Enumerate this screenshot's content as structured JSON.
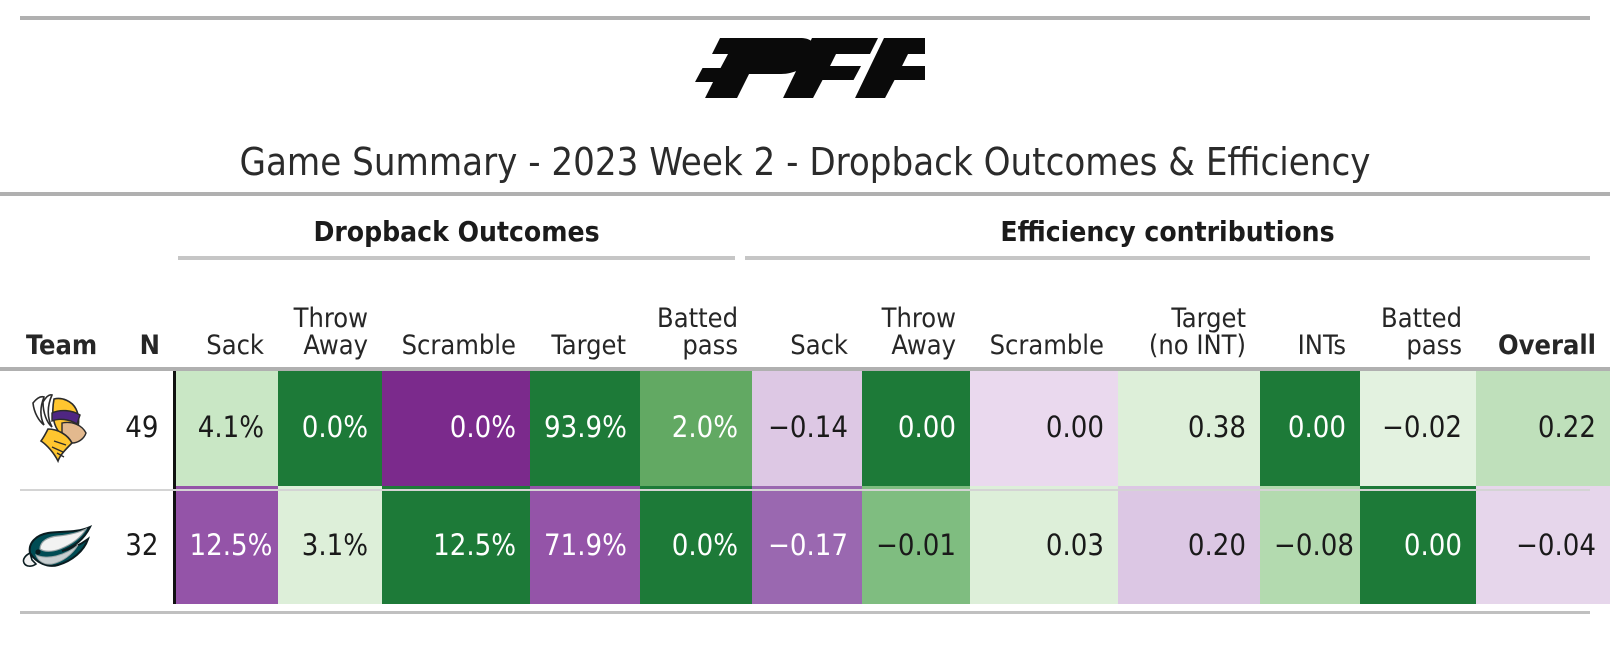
{
  "brand": {
    "logo_text": "PFF",
    "logo_name": "pff-logo"
  },
  "title": "Game Summary - 2023 Week 2 - Dropback Outcomes & Efficiency",
  "groups": {
    "left": "Dropback Outcomes",
    "right": "Efficiency contributions"
  },
  "columns": [
    {
      "key": "team",
      "label": "Team",
      "bold": true
    },
    {
      "key": "n",
      "label": "N",
      "bold": true
    },
    {
      "key": "o_sack",
      "label": "Sack",
      "bold": false
    },
    {
      "key": "o_throw",
      "label": "Throw\nAway",
      "bold": false
    },
    {
      "key": "o_scr",
      "label": "Scramble",
      "bold": false
    },
    {
      "key": "o_tgt",
      "label": "Target",
      "bold": false
    },
    {
      "key": "o_batted",
      "label": "Batted\npass",
      "bold": false
    },
    {
      "key": "e_sack",
      "label": "Sack",
      "bold": false
    },
    {
      "key": "e_throw",
      "label": "Throw\nAway",
      "bold": false
    },
    {
      "key": "e_scr",
      "label": "Scramble",
      "bold": false
    },
    {
      "key": "e_tgt",
      "label": "Target\n(no INT)",
      "bold": false
    },
    {
      "key": "e_int",
      "label": "INTs",
      "bold": false
    },
    {
      "key": "e_batted",
      "label": "Batted\npass",
      "bold": false
    },
    {
      "key": "e_overall",
      "label": "Overall",
      "bold": true
    }
  ],
  "rows": [
    {
      "team": "Minnesota Vikings",
      "team_logo": "vikings-logo",
      "n": "49",
      "cells": [
        {
          "value": "4.1%",
          "bg": "#c9e7c5",
          "fg": "#1a1a1a"
        },
        {
          "value": "0.0%",
          "bg": "#1d7a38",
          "fg": "#ffffff"
        },
        {
          "value": "0.0%",
          "bg": "#7b2a8c",
          "fg": "#ffffff"
        },
        {
          "value": "93.9%",
          "bg": "#1d7a38",
          "fg": "#ffffff"
        },
        {
          "value": "2.0%",
          "bg": "#62a963",
          "fg": "#ffffff"
        },
        {
          "value": "−0.14",
          "bg": "#ddc8e4",
          "fg": "#1a1a1a"
        },
        {
          "value": "0.00",
          "bg": "#1d7a38",
          "fg": "#ffffff"
        },
        {
          "value": "0.00",
          "bg": "#ead9ee",
          "fg": "#1a1a1a"
        },
        {
          "value": "0.38",
          "bg": "#ddefd9",
          "fg": "#1a1a1a"
        },
        {
          "value": "0.00",
          "bg": "#1d7a38",
          "fg": "#ffffff"
        },
        {
          "value": "−0.02",
          "bg": "#e3f2e0",
          "fg": "#1a1a1a"
        },
        {
          "value": "0.22",
          "bg": "#bfe0bb",
          "fg": "#1a1a1a"
        }
      ]
    },
    {
      "team": "Philadelphia Eagles",
      "team_logo": "eagles-logo",
      "n": "32",
      "cells": [
        {
          "value": "12.5%",
          "bg": "#9454a8",
          "fg": "#ffffff"
        },
        {
          "value": "3.1%",
          "bg": "#ddefd9",
          "fg": "#1a1a1a"
        },
        {
          "value": "12.5%",
          "bg": "#1d7a38",
          "fg": "#ffffff"
        },
        {
          "value": "71.9%",
          "bg": "#9454a8",
          "fg": "#ffffff"
        },
        {
          "value": "0.0%",
          "bg": "#1d7a38",
          "fg": "#ffffff"
        },
        {
          "value": "−0.17",
          "bg": "#9a68b0",
          "fg": "#ffffff"
        },
        {
          "value": "−0.01",
          "bg": "#7fbd80",
          "fg": "#1a1a1a"
        },
        {
          "value": "0.03",
          "bg": "#ddefd9",
          "fg": "#1a1a1a"
        },
        {
          "value": "0.20",
          "bg": "#dcc7e4",
          "fg": "#1a1a1a"
        },
        {
          "value": "−0.08",
          "bg": "#b3daaf",
          "fg": "#1a1a1a"
        },
        {
          "value": "0.00",
          "bg": "#1d7a38",
          "fg": "#ffffff"
        },
        {
          "value": "−0.04",
          "bg": "#e6d6eb",
          "fg": "#1a1a1a"
        }
      ]
    }
  ],
  "chart_data": {
    "type": "table",
    "title": "Game Summary - 2023 Week 2 - Dropback Outcomes & Efficiency",
    "column_groups": [
      "Dropback Outcomes",
      "Efficiency contributions"
    ],
    "columns": [
      "Team",
      "N",
      "Sack",
      "Throw Away",
      "Scramble",
      "Target",
      "Batted pass",
      "Sack",
      "Throw Away",
      "Scramble",
      "Target (no INT)",
      "INTs",
      "Batted pass",
      "Overall"
    ],
    "rows": [
      {
        "team": "Minnesota Vikings",
        "n": 49,
        "dropback_outcomes": {
          "sack": "4.1%",
          "throw_away": "0.0%",
          "scramble": "0.0%",
          "target": "93.9%",
          "batted_pass": "2.0%"
        },
        "efficiency": {
          "sack": -0.14,
          "throw_away": 0.0,
          "scramble": 0.0,
          "target_no_int": 0.38,
          "ints": 0.0,
          "batted_pass": -0.02,
          "overall": 0.22
        }
      },
      {
        "team": "Philadelphia Eagles",
        "n": 32,
        "dropback_outcomes": {
          "sack": "12.5%",
          "throw_away": "3.1%",
          "scramble": "12.5%",
          "target": "71.9%",
          "batted_pass": "0.0%"
        },
        "efficiency": {
          "sack": -0.17,
          "throw_away": -0.01,
          "scramble": 0.03,
          "target_no_int": 0.2,
          "ints": -0.08,
          "batted_pass": 0.0,
          "overall": -0.04
        }
      }
    ],
    "colorscale": {
      "positive": "#1d7a38",
      "neutral": "#ffffff",
      "negative": "#7b2a8c"
    }
  }
}
